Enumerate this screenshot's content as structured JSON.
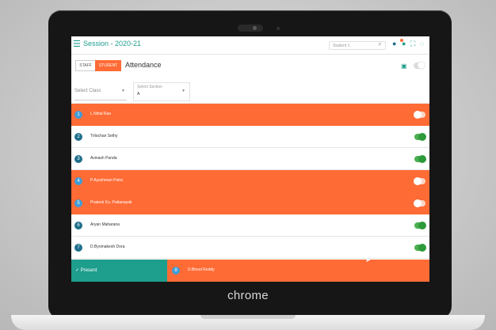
{
  "app": {
    "session_title": "Session - 2020-21",
    "search_placeholder": "Student 1",
    "page_title": "Attendance",
    "tabs": {
      "staff": "STAFF",
      "student": "STUDENT"
    }
  },
  "filters": {
    "class_placeholder": "Select Class",
    "section_label": "Select Section",
    "section_value": "A"
  },
  "students": [
    {
      "num": "1",
      "name": "L.Nihal Rao",
      "status": "absent"
    },
    {
      "num": "2",
      "name": "Trilochan Sethy",
      "status": "present"
    },
    {
      "num": "3",
      "name": "Avinash Panda",
      "status": "present"
    },
    {
      "num": "4",
      "name": "P.Ayushman Patra",
      "status": "absent"
    },
    {
      "num": "5",
      "name": "Prateek Ku. Pattanayak",
      "status": "absent"
    },
    {
      "num": "6",
      "name": "Aryan Maharana",
      "status": "present"
    },
    {
      "num": "7",
      "name": "D.Byomakesh Dora",
      "status": "present"
    }
  ],
  "footer": {
    "present_label": "✓ Present",
    "absent_num": "8",
    "absent_name": "D.Binod Reddy"
  },
  "device": {
    "brand": "chrome"
  },
  "colors": {
    "accent_teal": "#1e9e8c",
    "accent_orange": "#ff6b35"
  }
}
